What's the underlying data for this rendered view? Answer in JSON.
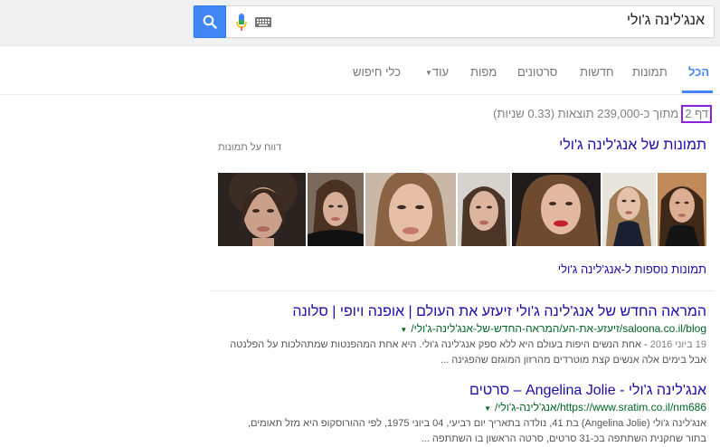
{
  "search": {
    "query": "אנג'לינה ג'ולי"
  },
  "tabs": {
    "all": "הכל",
    "images": "תמונות",
    "news": "חדשות",
    "videos": "סרטונים",
    "maps": "מפות",
    "more": "עוד",
    "tools": "כלי חיפוש"
  },
  "stats": {
    "page": "דף 2",
    "text": "מתוך כ-239,000 תוצאות (0.33 שניות)"
  },
  "images_section": {
    "heading": "תמונות של אנג'לינה ג'ולי",
    "report": "דווח על תמונות",
    "more": "תמונות נוספות ל-אנג'לינה ג'ולי"
  },
  "results": [
    {
      "title": "המראה החדש של אנג'לינה ג'ולי זיעזע את העולם | אופנה ויופי | סלונה",
      "url": "saloona.co.il/blog/זיעזע-את-הע/המראה-החדש-של-אנג'לינה-ג'ולי/",
      "date": "19 ביוני 2016",
      "snippet_line1": " - אחת הנשים היפות בעולם היא ללא ספק אנג'לינה ג'ולי. היא אחת המהפנטות שמתהלכות על הפלנטה",
      "snippet_line2": "אבל בימים אלה אנשים קצת מוטרדים מהרזון המוגזם שהפגינה ..."
    },
    {
      "title": "אנג'לינה ג'ולי - Angelina Jolie – סרטים",
      "url": "https://www.sratim.co.il/nm686/אנג'לינה-ג'ולי/",
      "snippet_line1": "אנג'לינה ג'ולי (Angelina Jolie) בת 41, נולדה בתאריך יום רביעי, 04 ביוני 1975, לפי ההורוסקופ היא מזל תאומים,",
      "snippet_line2": "בתור שחקנית השתתפה בכ-31 סרטים, סרטה הראשון בו השתתפה ..."
    }
  ],
  "colors": {
    "link": "#1a0dab",
    "url": "#006621",
    "accent": "#4285f4",
    "page_highlight": "#8b24d6"
  }
}
